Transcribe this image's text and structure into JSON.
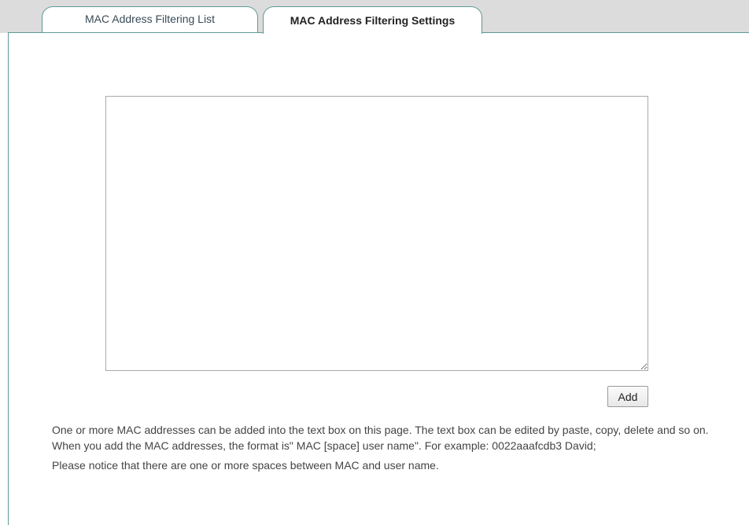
{
  "tabs": [
    {
      "label": "MAC Address Filtering List",
      "active": false
    },
    {
      "label": "MAC Address Filtering Settings",
      "active": true
    }
  ],
  "textbox": {
    "value": "",
    "placeholder": ""
  },
  "add_button": {
    "label": "Add"
  },
  "notes": [
    "One or more MAC addresses can be added into the text box on this page. The text box can be edited by paste, copy, delete and so on.",
    "When you add the MAC addresses, the format is\" MAC [space] user name\". For example: 0022aaafcdb3 David;",
    "Please notice that there are one or more spaces between MAC and user name."
  ],
  "colors": {
    "tab_border": "#5f9a95",
    "tab_strip_bg": "#dcdcdc",
    "text": "#444444"
  }
}
